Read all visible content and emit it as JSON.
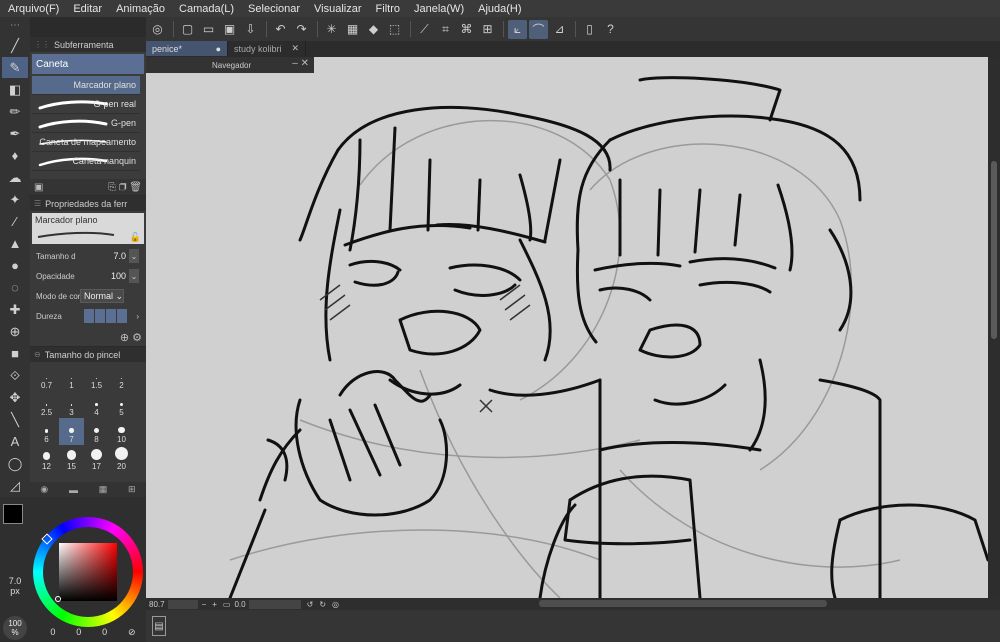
{
  "menu": [
    "Arquivo(F)",
    "Editar",
    "Animação",
    "Camada(L)",
    "Selecionar",
    "Visualizar",
    "Filtro",
    "Janela(W)",
    "Ajuda(H)"
  ],
  "subtool_panel": {
    "title": "Subferramenta",
    "group": "Caneta",
    "brushes": [
      "Marcador plano",
      "G-pen real",
      "G-pen",
      "Caneta de mapeamento",
      "Caneta nanquin"
    ]
  },
  "tool_property": {
    "title": "Propriedades da ferr",
    "preset_name": "Marcador plano",
    "size_label": "Tamanho d",
    "size_value": "7.0",
    "opacity_label": "Opacidade",
    "opacity_value": "100",
    "blend_label": "Modo de cor",
    "blend_value": "Normal",
    "hardness_label": "Dureza"
  },
  "brush_size": {
    "title": "Tamanho do pincel",
    "sizes": [
      "0.7",
      "1",
      "1.5",
      "2",
      "2.5",
      "3",
      "4",
      "5",
      "6",
      "7",
      "8",
      "10",
      "12",
      "15",
      "17",
      "20"
    ],
    "selected": "7"
  },
  "color": {
    "main": "#000000",
    "sub": "#ffffff",
    "values": [
      "0",
      "0",
      "0"
    ],
    "size_display": "7.0\npx",
    "zoom_display": "100\n%"
  },
  "tabs": [
    {
      "label": "penice*",
      "active": true
    },
    {
      "label": "study kolibri",
      "active": false
    }
  ],
  "navigator": {
    "title": "Navegador"
  },
  "status": {
    "zoom": "80.7",
    "angle": "0.0"
  }
}
